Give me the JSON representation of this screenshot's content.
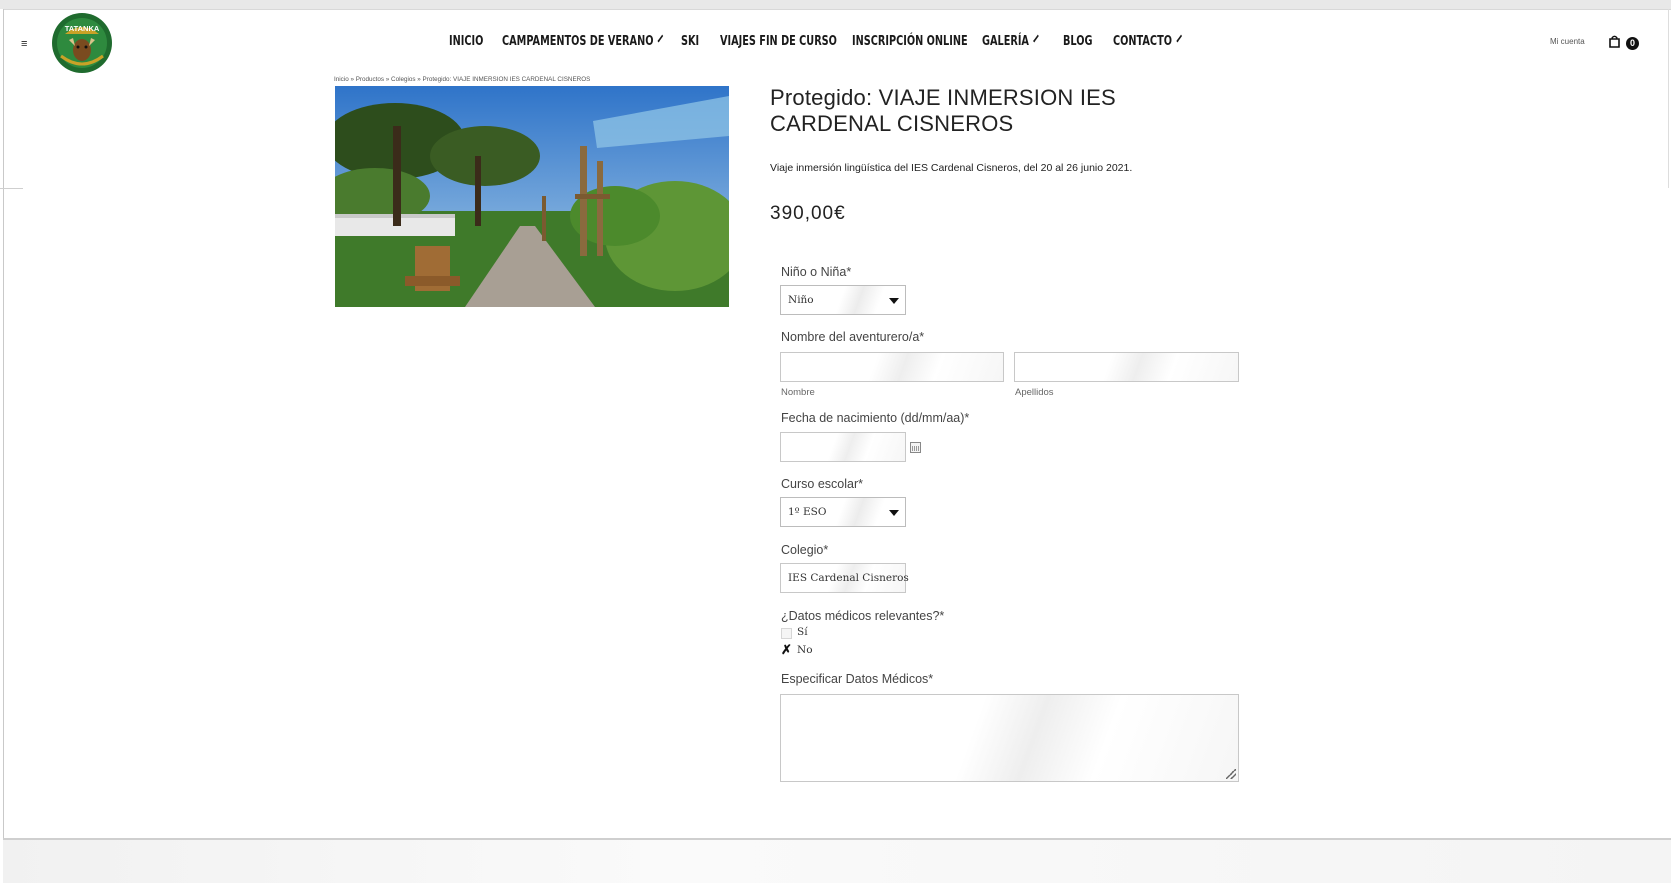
{
  "header": {
    "menu_toggle": "≡",
    "logo_text": "TATANKA",
    "nav": [
      {
        "label": "INICIO",
        "dropdown": false
      },
      {
        "label": "CAMPAMENTOS DE VERANO",
        "dropdown": true
      },
      {
        "label": "SKI",
        "dropdown": false
      },
      {
        "label": "VIAJES FIN DE CURSO",
        "dropdown": false
      },
      {
        "label": "INSCRIPCIÓN ONLINE",
        "dropdown": false
      },
      {
        "label": "GALERÍA",
        "dropdown": true
      },
      {
        "label": "BLOG",
        "dropdown": false
      },
      {
        "label": "CONTACTO",
        "dropdown": true
      }
    ],
    "account_label": "Mi cuenta",
    "cart_count": "0"
  },
  "breadcrumb": "Inicio » Productos » Colegios » Protegido: VIAJE INMERSION IES CARDENAL CISNEROS",
  "product": {
    "title": "Protegido: VIAJE INMERSION IES CARDENAL CISNEROS",
    "description": "Viaje inmersión lingüística del IES Cardenal Cisneros, del 20 al 26 junio 2021.",
    "price": "390,00€"
  },
  "form": {
    "gender": {
      "label": "Niño o Niña*",
      "value": "Niño"
    },
    "name": {
      "label": "Nombre del aventurero/a*",
      "first_sublabel": "Nombre",
      "last_sublabel": "Apellidos",
      "first_value": "",
      "last_value": ""
    },
    "birthdate": {
      "label": "Fecha de nacimiento (dd/mm/aa)*",
      "value": ""
    },
    "course": {
      "label": "Curso escolar*",
      "value": "1º ESO"
    },
    "school": {
      "label": "Colegio*",
      "value": "IES Cardenal Cisneros"
    },
    "medical": {
      "label": "¿Datos médicos relevantes?*",
      "options": [
        "Sí",
        "No"
      ],
      "selected": "No"
    },
    "medical_details": {
      "label": "Especificar Datos Médicos*",
      "value": ""
    }
  },
  "colors": {
    "accent": "#1a1a1a",
    "logo_green": "#1f6b2e",
    "logo_gold": "#c9a227"
  }
}
